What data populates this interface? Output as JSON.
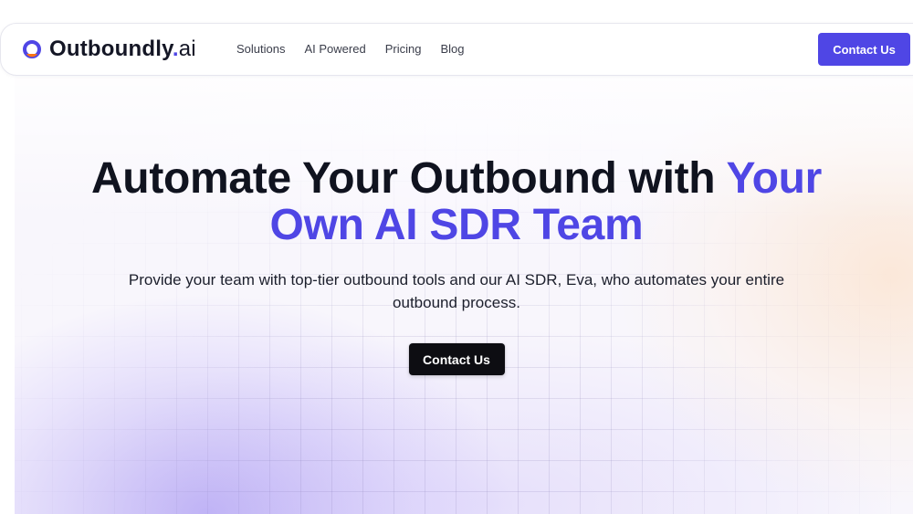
{
  "brand": {
    "name": "Outboundly",
    "dot": ".",
    "suffix": "ai",
    "icon": "brand-ring-icon",
    "colors": {
      "ring": "#4f46e5",
      "accent": "#f97316"
    }
  },
  "nav": {
    "links": [
      "Solutions",
      "AI Powered",
      "Pricing",
      "Blog"
    ],
    "cta_label": "Contact Us"
  },
  "hero": {
    "title_part1": "Automate Your Outbound with ",
    "title_accent": "Your Own AI SDR Team",
    "subtitle": "Provide your team with top-tier outbound tools and our AI SDR, Eva, who automates your entire outbound process.",
    "cta_label": "Contact Us"
  },
  "theme": {
    "primary": "#4f46e5",
    "dark_button": "#0d0d12",
    "text": "#10131f"
  }
}
